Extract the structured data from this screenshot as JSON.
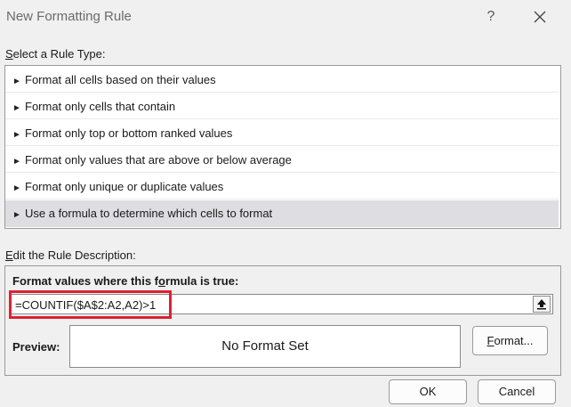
{
  "window": {
    "title": "New Formatting Rule",
    "help": "?"
  },
  "rule_type": {
    "label_first": "S",
    "label_rest": "elect a Rule Type:",
    "items": [
      {
        "label": "Format all cells based on their values",
        "selected": false
      },
      {
        "label": "Format only cells that contain",
        "selected": false
      },
      {
        "label": "Format only top or bottom ranked values",
        "selected": false
      },
      {
        "label": "Format only values that are above or below average",
        "selected": false
      },
      {
        "label": "Format only unique or duplicate values",
        "selected": false
      },
      {
        "label": "Use a formula to determine which cells to format",
        "selected": true
      }
    ]
  },
  "description": {
    "label_first": "E",
    "label_rest": "dit the Rule Description:",
    "formula_head_first": "Format values where this f",
    "formula_head_u": "o",
    "formula_head_rest": "rmula is true:",
    "formula_value": "=COUNTIF($A$2:A2,A2)>1",
    "preview_label": "Preview:",
    "preview_text": "No Format Set",
    "format_button_u": "F",
    "format_button_rest": "ormat..."
  },
  "buttons": {
    "ok": "OK",
    "cancel": "Cancel"
  },
  "colors": {
    "selected_row": "#dedee2",
    "highlight": "#e02030"
  }
}
